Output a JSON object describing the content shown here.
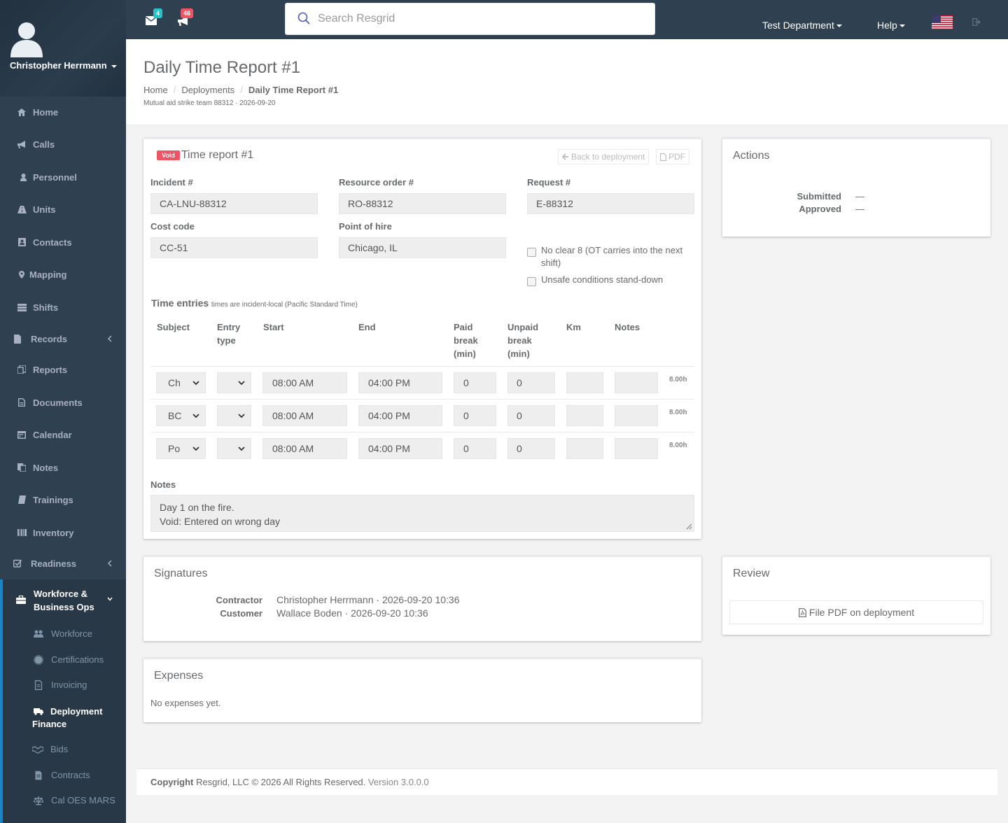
{
  "user": {
    "name": "Christopher Herrmann"
  },
  "sidebar": {
    "items": [
      {
        "label": "Home",
        "icon": "home-icon"
      },
      {
        "label": "Calls",
        "icon": "bullhorn-icon"
      },
      {
        "label": "Personnel",
        "icon": "user-icon"
      },
      {
        "label": "Units",
        "icon": "road-icon"
      },
      {
        "label": "Contacts",
        "icon": "address-book-icon"
      },
      {
        "label": "Mapping",
        "icon": "map-marker-icon"
      },
      {
        "label": "Shifts",
        "icon": "tasks-icon"
      },
      {
        "label": "Records",
        "icon": "file-icon"
      },
      {
        "label": "Reports",
        "icon": "reports-icon"
      },
      {
        "label": "Documents",
        "icon": "document-icon"
      },
      {
        "label": "Calendar",
        "icon": "calendar-icon"
      },
      {
        "label": "Notes",
        "icon": "notes-icon"
      },
      {
        "label": "Trainings",
        "icon": "book-icon"
      },
      {
        "label": "Inventory",
        "icon": "barcode-icon"
      },
      {
        "label": "Readiness",
        "icon": "check-square-icon"
      }
    ],
    "ops": {
      "label": "Workforce & Business Ops",
      "label_line1": "Workforce &",
      "label_line2": "Business Ops",
      "items": [
        {
          "label": "Workforce",
          "icon": "users-icon"
        },
        {
          "label": "Certifications",
          "icon": "certificate-icon"
        },
        {
          "label": "Invoicing",
          "icon": "invoice-icon"
        },
        {
          "label": "Deployment Finance",
          "label_line1": "Deployment",
          "label_line2": "Finance",
          "icon": "truck-icon",
          "active": true
        },
        {
          "label": "Bids",
          "icon": "handshake-icon"
        },
        {
          "label": "Contracts",
          "icon": "contract-icon"
        },
        {
          "label": "Cal OES MARS",
          "icon": "balance-scale-icon"
        }
      ]
    }
  },
  "topbar": {
    "mail_badge": "4",
    "alerts_badge": "46",
    "search_placeholder": "Search Resgrid",
    "department": "Test Department",
    "help": "Help",
    "colors": {
      "mail_badge": "#23c6c8",
      "alerts_badge": "#ed5565"
    }
  },
  "page": {
    "title": "Daily Time Report #1",
    "breadcrumb": [
      "Home",
      "Deployments",
      "Daily Time Report #1"
    ],
    "subtitle": "Mutual aid strike team 88312 · 2026-09-20"
  },
  "report": {
    "status_badge": "Void",
    "title": "Time report #1",
    "back_button": "Back to deployment",
    "pdf_button": "PDF",
    "fields": {
      "incident_label": "Incident #",
      "incident_value": "CA-LNU-88312",
      "resource_order_label": "Resource order #",
      "resource_order_value": "RO-88312",
      "request_label": "Request #",
      "request_value": "E-88312",
      "cost_code_label": "Cost code",
      "cost_code_value": "CC-51",
      "point_of_hire_label": "Point of hire",
      "point_of_hire_value": "Chicago, IL"
    },
    "checkboxes": {
      "no_clear_line1": "No clear 8 (OT carries into the next",
      "no_clear_line2": "shift)",
      "unsafe": "Unsafe conditions stand-down"
    },
    "time_entries": {
      "label": "Time entries",
      "note": "times are incident-local (Pacific Standard Time)",
      "headers": {
        "subject": "Subject",
        "entry_type_1": "Entry",
        "entry_type_2": "type",
        "start": "Start",
        "end": "End",
        "paid_1": "Paid",
        "paid_2": "break",
        "paid_3": "(min)",
        "unpaid_1": "Unpaid",
        "unpaid_2": "break",
        "unpaid_3": "(min)",
        "km": "Km",
        "notes": "Notes"
      },
      "rows": [
        {
          "subject": "Ch",
          "start": "08:00 AM",
          "end": "04:00 PM",
          "paid": "0",
          "unpaid": "0",
          "km": "",
          "notes": "",
          "hours": "8.00h"
        },
        {
          "subject": "BC",
          "start": "08:00 AM",
          "end": "04:00 PM",
          "paid": "0",
          "unpaid": "0",
          "km": "",
          "notes": "",
          "hours": "8.00h"
        },
        {
          "subject": "Po",
          "start": "08:00 AM",
          "end": "04:00 PM",
          "paid": "0",
          "unpaid": "0",
          "km": "",
          "notes": "",
          "hours": "8.00h"
        }
      ]
    },
    "notes_label": "Notes",
    "notes_line1": "Day 1 on the fire.",
    "notes_line2": "Void: Entered on wrong day"
  },
  "actions": {
    "title": "Actions",
    "submitted_label": "Submitted",
    "submitted_value": "—",
    "approved_label": "Approved",
    "approved_value": "—"
  },
  "signatures": {
    "title": "Signatures",
    "contractor_label": "Contractor",
    "contractor_value": "Christopher Herrmann · 2026-09-20 10:36",
    "customer_label": "Customer",
    "customer_value": "Wallace Boden · 2026-09-20 10:36"
  },
  "review": {
    "title": "Review",
    "button": "File PDF on deployment"
  },
  "expenses": {
    "title": "Expenses",
    "empty": "No expenses yet."
  },
  "footer": {
    "copyright": "Copyright",
    "company": "Resgrid, LLC © 2026 All Rights Reserved.",
    "version": "Version 3.0.0.0"
  }
}
